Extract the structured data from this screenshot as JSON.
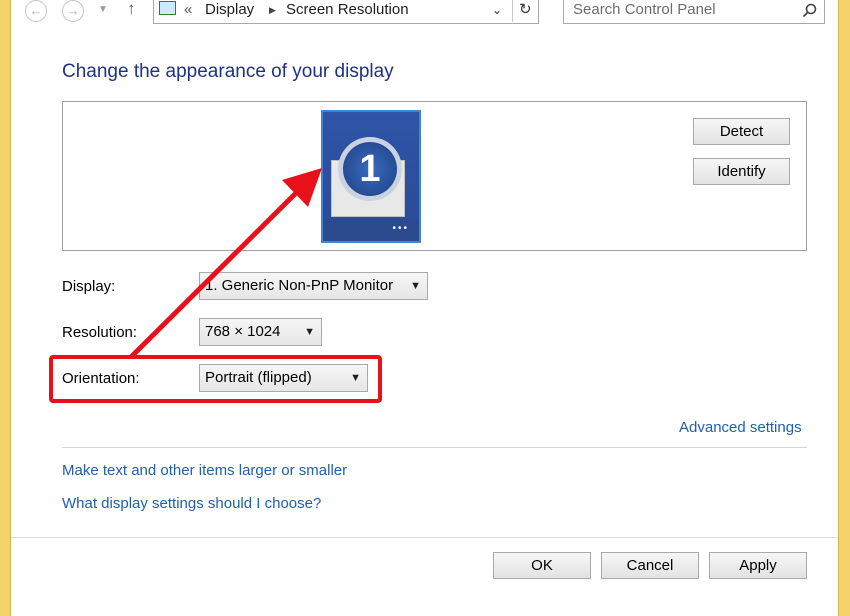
{
  "address_bar": {
    "breadcrumb_sep": "«",
    "crumbs": [
      "Display",
      "Screen Resolution"
    ]
  },
  "search": {
    "placeholder": "Search Control Panel"
  },
  "heading": "Change the appearance of your display",
  "monitor": {
    "number": "1"
  },
  "buttons": {
    "detect": "Detect",
    "identify": "Identify",
    "ok": "OK",
    "cancel": "Cancel",
    "apply": "Apply"
  },
  "fields": {
    "display": {
      "label": "Display:",
      "value": "1. Generic Non-PnP Monitor"
    },
    "resolution": {
      "label": "Resolution:",
      "value": "768 × 1024"
    },
    "orientation": {
      "label": "Orientation:",
      "value": "Portrait (flipped)"
    }
  },
  "links": {
    "advanced": "Advanced settings",
    "text_size": "Make text and other items larger or smaller",
    "which_settings": "What display settings should I choose?"
  },
  "annotation": {
    "color": "#e8101b"
  }
}
